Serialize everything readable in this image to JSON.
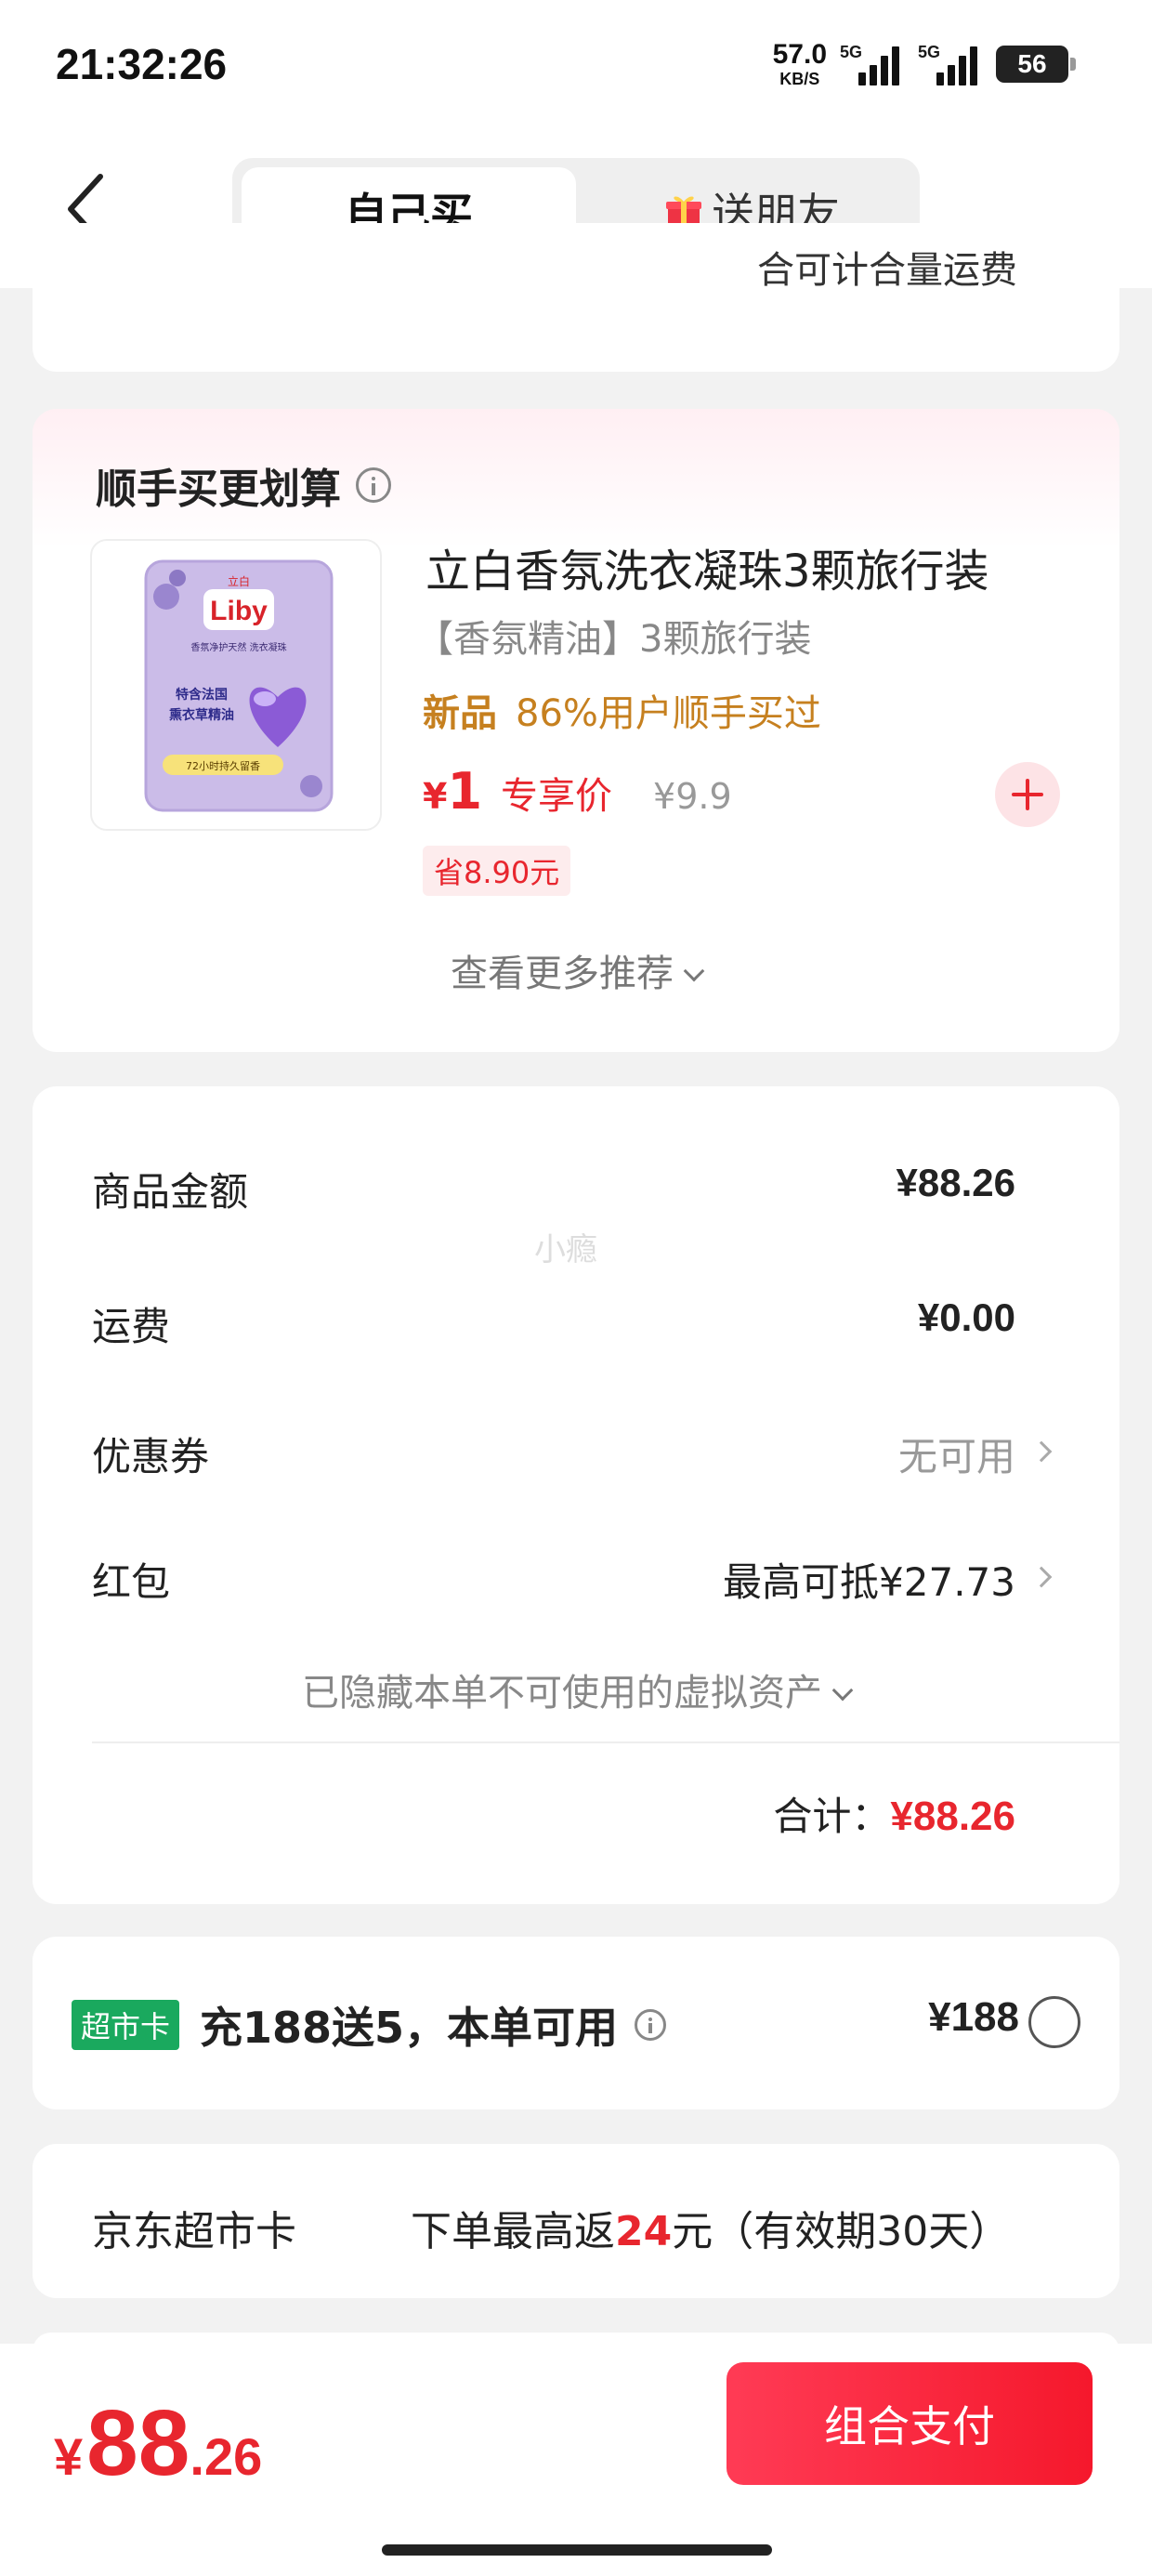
{
  "status_bar": {
    "time": "21:32:26",
    "net_speed": "57.0",
    "net_unit": "KB/S",
    "sim1": "5G",
    "sim2": "5G",
    "battery": "56"
  },
  "header": {
    "tab_self": "自己买",
    "tab_gift": "送朋友",
    "icons": {
      "back": "chevron-left-icon",
      "gift": "gift-icon"
    }
  },
  "top_card": {
    "clipped_text": "合可计合量运费"
  },
  "recommend": {
    "title": "顺手买更划算",
    "product": {
      "name": "立白香氛洗衣凝珠3颗旅行装",
      "spec": "【香氛精油】3颗旅行装",
      "new_tag": "新品",
      "buyers": "86%用户顺手买过",
      "price_symbol": "¥",
      "price": "1",
      "price_label": "专享价",
      "original_price": "¥9.9",
      "save": "省8.90元",
      "image_brand": "Liby",
      "image_cn_brand": "立白",
      "image_line1": "香氛净护天然 洗衣凝珠",
      "image_line2": "特含法国",
      "image_line3": "熏衣草精油",
      "image_line4": "72小时持久留香"
    },
    "more": "查看更多推荐"
  },
  "summary": {
    "watermark": "小瘾",
    "rows": [
      {
        "label": "商品金额",
        "value": "¥88.26"
      },
      {
        "label": "运费",
        "value": "¥0.00"
      },
      {
        "label": "优惠券",
        "value": "无可用"
      },
      {
        "label": "红包",
        "value": "最高可抵¥27.73"
      }
    ],
    "hidden_assets": "已隐藏本单不可使用的虚拟资产",
    "total_label": "合计：",
    "total_value": "¥88.26"
  },
  "market_card": {
    "badge": "超市卡",
    "offer": "充188送5，本单可用",
    "price": "¥188"
  },
  "jd_card": {
    "label": "京东超市卡",
    "desc_prefix": "下单最高返",
    "desc_amount": "24",
    "desc_suffix": "元（有效期30天）"
  },
  "bottom": {
    "symbol": "¥",
    "amount_int": "88",
    "amount_dec": ".26",
    "pay_button": "组合支付"
  },
  "colors": {
    "accent_red": "#e8262e",
    "tag_orange": "#c6801f",
    "badge_green": "#1aa95e"
  }
}
